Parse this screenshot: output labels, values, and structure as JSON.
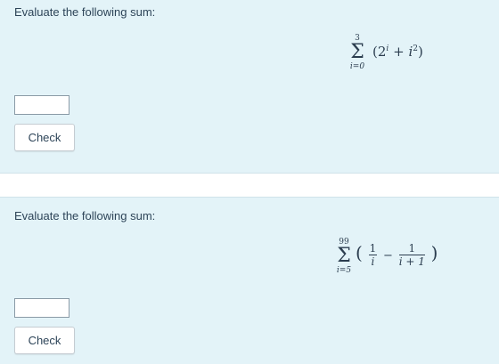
{
  "questions": [
    {
      "prompt": "Evaluate the following sum:",
      "sum": {
        "upper": "3",
        "lower": "i=0",
        "sigma": "Σ",
        "open_paren": "(",
        "term_a_base": "2",
        "term_a_exp": "i",
        "plus": "+",
        "term_b_base": "i",
        "term_b_exp": "2",
        "close_paren": ")"
      },
      "answer_value": "",
      "check_label": "Check"
    },
    {
      "prompt": "Evaluate the following sum:",
      "sum": {
        "upper": "99",
        "lower": "i=5",
        "sigma": "Σ",
        "open_paren": "(",
        "frac1_num": "1",
        "frac1_den": "i",
        "minus": "−",
        "frac2_num": "1",
        "frac2_den": "i + 1",
        "close_paren": ")"
      },
      "answer_value": "",
      "check_label": "Check"
    }
  ],
  "colors": {
    "card_background": "#e3f3f8",
    "text": "#2d4458"
  }
}
